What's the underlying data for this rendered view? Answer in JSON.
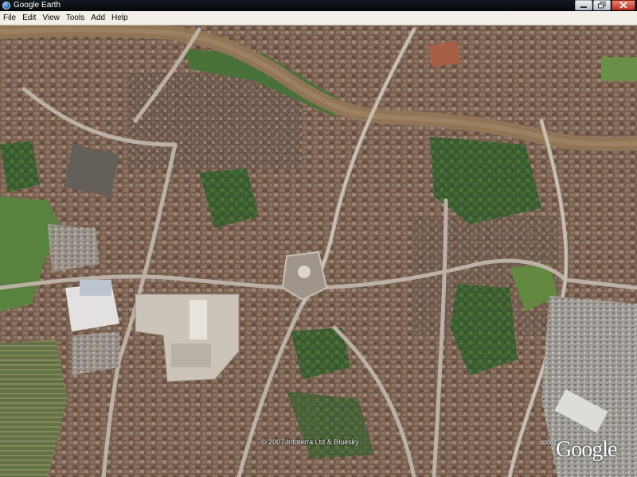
{
  "window": {
    "title": "Google Earth",
    "icon": "google-earth-globe-icon"
  },
  "menu": {
    "items": [
      "File",
      "Edit",
      "View",
      "Tools",
      "Add",
      "Help"
    ]
  },
  "map": {
    "copyright": "© 2007 Infoterra Ltd & Bluesky",
    "logo_text": "Google",
    "logo_small": "©2007"
  },
  "colors": {
    "river": "#8a6e4c",
    "grass": "#4f7a33",
    "trees": "#2f5a22",
    "roofs": "#7b5e48",
    "roads": "#b8ada0"
  }
}
